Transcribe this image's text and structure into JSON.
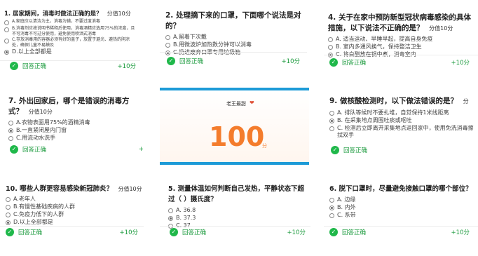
{
  "common": {
    "correct_label": "回答正确",
    "points_label": "+10分",
    "score_label": "分值10分"
  },
  "questions": [
    {
      "title": "1. 居家期间，消毒时做法正确的是？",
      "options": [
        "A.家庭应以清洁为主，消毒为辅，不要过度消毒",
        "B.消毒剂应按说明书稀释后使用，消毒酒精应选用75%的浓度，且不可消毒不可过分使用，避免使用喷洒式消毒",
        "C.存放消毒用的容器必须有好的盖子，放置于避光、避热的阴凉处，确保儿童不易触及",
        "D.以上全部都是"
      ],
      "selected": 3
    },
    {
      "title": "2. 处理摘下来的口罩，下面哪个说法是对的？",
      "options": [
        "A.留着下次戴",
        "B.用微波炉加热数分钟可以消毒",
        "C.扔进废弃口罩专用垃圾箱"
      ],
      "selected": 2
    },
    {
      "title": "4. 关于在家中预防新型冠状病毒感染的具体措施，以下说法不正确的是？",
      "options": [
        "A. 适当运动、早睡早起，提高自身免疫",
        "B. 室内多通风换气，保持整洁卫生",
        "C. 将白醋放在锅中煮，消毒室内"
      ],
      "selected": 2
    },
    {
      "title": "7. 外出回家后，哪个是错误的消毒方式？",
      "options": [
        "A.衣物表面用75%的酒精消毒",
        "B.一直紧闭屋内门窗",
        "C.用流动水洗手"
      ],
      "selected": 1,
      "points": "+"
    },
    {
      "title": "9. 做核酸检测时，以下做法错误的是？",
      "score": "分",
      "options": [
        "A. 排队等候时不要扎堆，自觉保持1米线距离",
        "B. 在采集地点周围吐痰或呕吐",
        "C. 检测后立即离开采集地点返回家中，使用免洗消毒擦拭双手"
      ],
      "selected": 1
    },
    {
      "title": "10. 哪些人群更容易感染新冠肺炎？",
      "options": [
        "A.老年人",
        "B.有慢性基础疾病的人群",
        "C.免疫力低下的人群",
        "D.以上全部都是"
      ],
      "selected": 3
    },
    {
      "title": "5. 测量体温如何判断自己发热，平静状态下超过（ ）摄氏度？",
      "options": [
        "A. 36.8",
        "B. 37.3",
        "C. 37"
      ],
      "selected": 1
    },
    {
      "title": "6. 脱下口罩时，尽量避免接触口罩的哪个部位？",
      "options": [
        "A. 边缘",
        "B. 内外",
        "C. 系带"
      ],
      "selected": 1
    }
  ],
  "result_card": {
    "user_name": "老王最甜",
    "score": "100",
    "unit": "分"
  },
  "colors": {
    "correct_green": "#1fb84a",
    "score_orange": "#f47c2c",
    "card_blue": "#1d9bd7"
  }
}
